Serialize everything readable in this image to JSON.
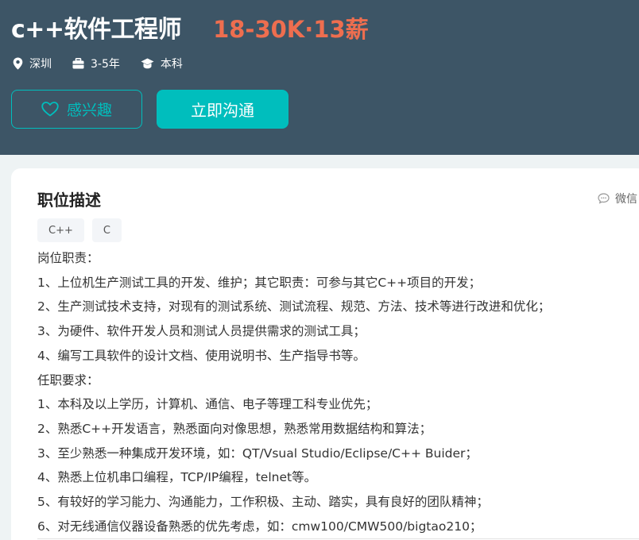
{
  "job": {
    "title": "c++软件工程师",
    "salary": "18-30K·13薪"
  },
  "meta": {
    "location": "深圳",
    "experience": "3-5年",
    "education": "本科"
  },
  "actions": {
    "interest_label": "感兴趣",
    "chat_label": "立即沟通"
  },
  "description": {
    "title": "职位描述",
    "wechat_label": "微信",
    "tags": [
      "C++",
      "C"
    ],
    "lines": [
      "岗位职责：",
      "1、上位机生产测试工具的开发、维护；其它职责：可参与其它C++项目的开发；",
      "2、生产测试技术支持，对现有的测试系统、测试流程、规范、方法、技术等进行改进和优化；",
      "3、为硬件、软件开发人员和测试人员提供需求的测试工具；",
      "4、编写工具软件的设计文档、使用说明书、生产指导书等。",
      "任职要求：",
      "1、本科及以上学历，计算机、通信、电子等理工科专业优先；",
      "2、熟悉C++开发语言，熟悉面向对像思想，熟悉常用数据结构和算法；",
      "3、至少熟悉一种集成开发环境，如：QT/Vsual Studio/Eclipse/C++ Buider；",
      "4、熟悉上位机串口编程，TCP/IP编程，telnet等。",
      "5、有较好的学习能力、沟通能力，工作积极、主动、踏实，具有良好的团队精神；",
      "6、对无线通信仪器设备熟悉的优先考虑，如：cmw100/CMW500/bigtao210；"
    ]
  },
  "colors": {
    "header_bg": "#3d5566",
    "accent": "#00bebd",
    "salary": "#ee6e4f"
  },
  "icons": {
    "location": "location-pin-icon",
    "experience": "briefcase-icon",
    "education": "graduation-cap-icon",
    "interest": "heart-icon",
    "wechat": "chat-bubble-icon"
  }
}
